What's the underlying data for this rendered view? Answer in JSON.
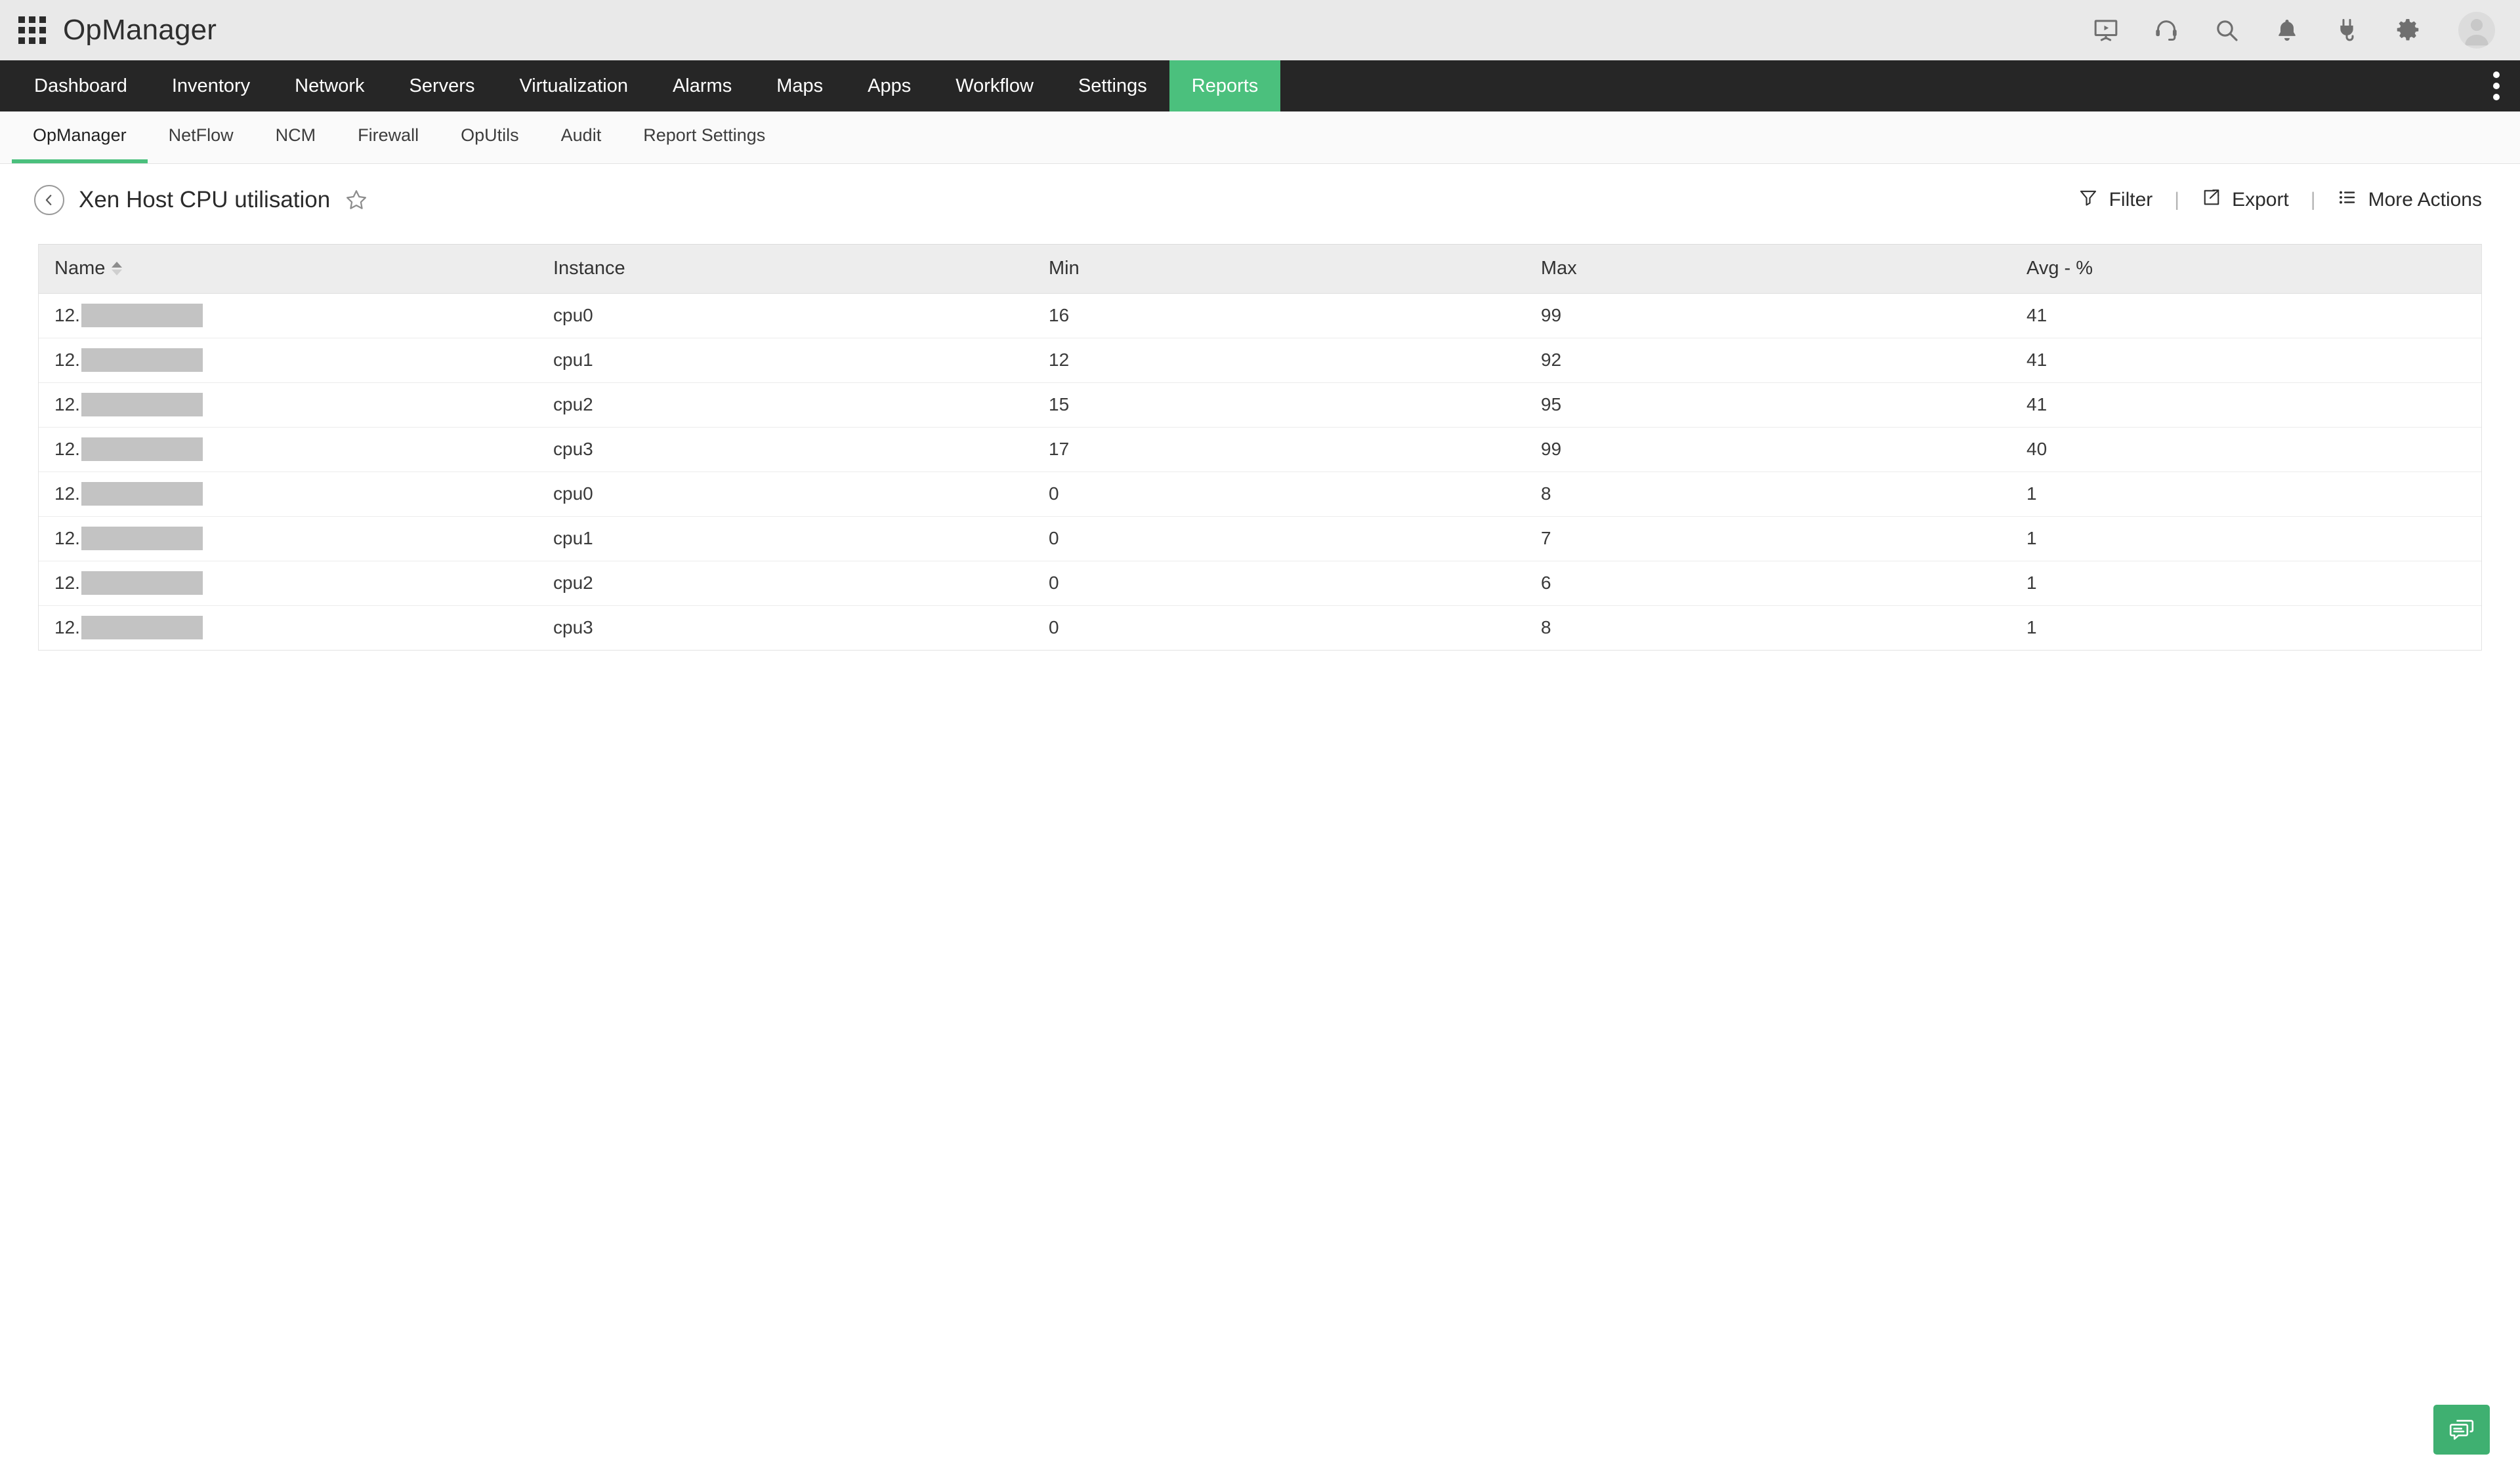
{
  "brand": {
    "title": "OpManager",
    "menu_icon": "apps-grid-icon",
    "icons": [
      {
        "name": "presentation-icon"
      },
      {
        "name": "headset-support-icon"
      },
      {
        "name": "search-icon"
      },
      {
        "name": "notification-bell-icon"
      },
      {
        "name": "plug-icon"
      },
      {
        "name": "gear-icon"
      },
      {
        "name": "user-avatar"
      }
    ]
  },
  "mainnav": {
    "items": [
      {
        "label": "Dashboard",
        "active": false
      },
      {
        "label": "Inventory",
        "active": false
      },
      {
        "label": "Network",
        "active": false
      },
      {
        "label": "Servers",
        "active": false
      },
      {
        "label": "Virtualization",
        "active": false
      },
      {
        "label": "Alarms",
        "active": false
      },
      {
        "label": "Maps",
        "active": false
      },
      {
        "label": "Apps",
        "active": false
      },
      {
        "label": "Workflow",
        "active": false
      },
      {
        "label": "Settings",
        "active": false
      },
      {
        "label": "Reports",
        "active": true
      }
    ],
    "overflow_icon": "kebab-menu-icon",
    "active_color": "#4bc07d",
    "background": "#262626"
  },
  "subnav": {
    "items": [
      {
        "label": "OpManager",
        "active": true
      },
      {
        "label": "NetFlow",
        "active": false
      },
      {
        "label": "NCM",
        "active": false
      },
      {
        "label": "Firewall",
        "active": false
      },
      {
        "label": "OpUtils",
        "active": false
      },
      {
        "label": "Audit",
        "active": false
      },
      {
        "label": "Report Settings",
        "active": false
      }
    ]
  },
  "pagehead": {
    "back_icon": "back-chevron-icon",
    "title": "Xen Host CPU utilisation",
    "favorite_icon": "star-outline-icon",
    "actions": [
      {
        "label": "Filter",
        "icon": "filter-funnel-icon"
      },
      {
        "label": "Export",
        "icon": "export-share-icon"
      },
      {
        "label": "More Actions",
        "icon": "list-menu-icon"
      }
    ],
    "separator": "|"
  },
  "table": {
    "columns": [
      {
        "label": "Name",
        "sorted": "asc"
      },
      {
        "label": "Instance",
        "sorted": null
      },
      {
        "label": "Min",
        "sorted": null
      },
      {
        "label": "Max",
        "sorted": null
      },
      {
        "label": "Avg - %",
        "sorted": null
      }
    ],
    "rows": [
      {
        "name_prefix": "12.",
        "name_redacted": true,
        "instance": "cpu0",
        "min": "16",
        "max": "99",
        "avg": "41"
      },
      {
        "name_prefix": "12.",
        "name_redacted": true,
        "instance": "cpu1",
        "min": "12",
        "max": "92",
        "avg": "41"
      },
      {
        "name_prefix": "12.",
        "name_redacted": true,
        "instance": "cpu2",
        "min": "15",
        "max": "95",
        "avg": "41"
      },
      {
        "name_prefix": "12.",
        "name_redacted": true,
        "instance": "cpu3",
        "min": "17",
        "max": "99",
        "avg": "40"
      },
      {
        "name_prefix": "12.",
        "name_redacted": true,
        "instance": "cpu0",
        "min": "0",
        "max": "8",
        "avg": "1"
      },
      {
        "name_prefix": "12.",
        "name_redacted": true,
        "instance": "cpu1",
        "min": "0",
        "max": "7",
        "avg": "1"
      },
      {
        "name_prefix": "12.",
        "name_redacted": true,
        "instance": "cpu2",
        "min": "0",
        "max": "6",
        "avg": "1"
      },
      {
        "name_prefix": "12.",
        "name_redacted": true,
        "instance": "cpu3",
        "min": "0",
        "max": "8",
        "avg": "1"
      }
    ]
  },
  "chat_widget": {
    "icon": "chat-bubbles-icon",
    "color": "#3fb071"
  }
}
